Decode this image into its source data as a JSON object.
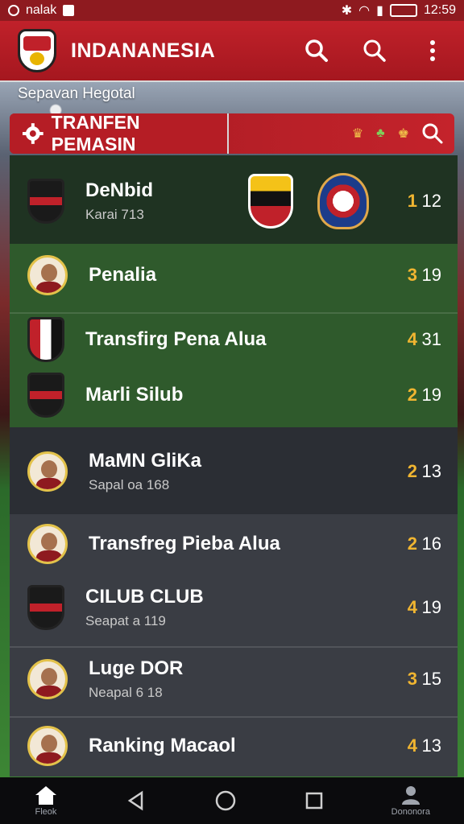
{
  "status_bar": {
    "carrier": "nalak",
    "time": "12:59"
  },
  "app_bar": {
    "title": "INDANANESIA"
  },
  "subheader": "Sepavan Hegotal",
  "section": {
    "title": "TRANFEN PEMASIN"
  },
  "rows": [
    {
      "name": "DeNbid",
      "sub": "Karai 713",
      "rank": "1",
      "score": "12"
    },
    {
      "name": "Penalia",
      "sub": "",
      "rank": "3",
      "score": "19"
    },
    {
      "name": "Transfirg Pena Alua",
      "sub": "",
      "rank": "4",
      "score": "31"
    },
    {
      "name": "Marli Silub",
      "sub": "",
      "rank": "2",
      "score": "19"
    },
    {
      "name": "MaMN GliKa",
      "sub": "Sapal oa 168",
      "rank": "2",
      "score": "13"
    },
    {
      "name": "Transfreg Pieba Alua",
      "sub": "",
      "rank": "2",
      "score": "16"
    },
    {
      "name": "CILUB CLUB",
      "sub": "Seapat a 119",
      "rank": "4",
      "score": "19"
    },
    {
      "name": "Luge DOR",
      "sub": "Neapal 6 18",
      "rank": "3",
      "score": "15"
    },
    {
      "name": "Ranking Macaol",
      "sub": "",
      "rank": "4",
      "score": "13"
    }
  ],
  "bottom_nav": {
    "home_label": "Fleok",
    "profile_label": "Dononora"
  },
  "colors": {
    "brand_red": "#c0212a",
    "rank_accent": "#f0b531",
    "row_dark": "#1f3322",
    "row_green": "#2f5a2c",
    "row_gray": "#3a3d44"
  }
}
